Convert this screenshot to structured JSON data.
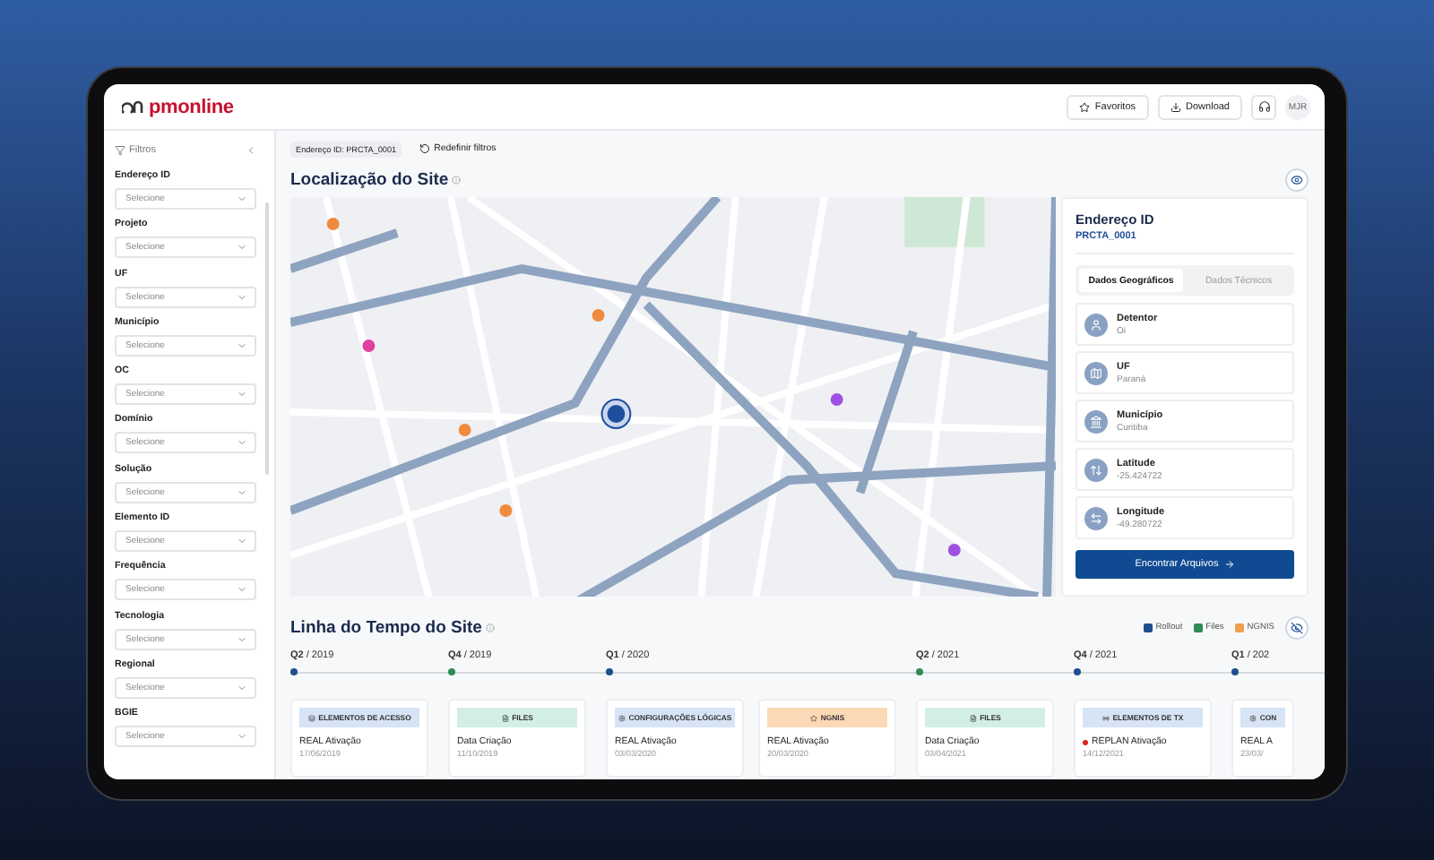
{
  "app": {
    "logo": "pmonline",
    "top_actions": [
      {
        "label": "Favoritos",
        "kind": "star"
      },
      {
        "label": "Download",
        "kind": "download"
      }
    ],
    "user": "MJR"
  },
  "sidebar": {
    "title": "Filtros",
    "filters": [
      {
        "label": "Endereço ID",
        "placeholder": "Selecione"
      },
      {
        "label": "Projeto",
        "placeholder": "Selecione"
      },
      {
        "label": "UF",
        "placeholder": "Selecione"
      },
      {
        "label": "Município",
        "placeholder": "Selecione"
      },
      {
        "label": "OC",
        "placeholder": "Selecione"
      },
      {
        "label": "Domínio",
        "placeholder": "Selecione"
      },
      {
        "label": "Solução",
        "placeholder": "Selecione"
      },
      {
        "label": "Elemento ID",
        "placeholder": "Selecione"
      },
      {
        "label": "Frequência",
        "placeholder": "Selecione"
      },
      {
        "label": "Tecnologia",
        "placeholder": "Selecione"
      },
      {
        "label": "Regional",
        "placeholder": "Selecione"
      },
      {
        "label": "BGIE",
        "placeholder": "Selecione"
      }
    ]
  },
  "breadcrumb": {
    "chip": "Endereço ID: PRCTA_0001",
    "reset": "Redefinir filtros"
  },
  "location": {
    "title": "Localização do Site",
    "card": {
      "title": "Endereço ID",
      "id": "PRCTA_0001",
      "tabs": [
        {
          "label": "Dados Geográficos",
          "selected": true
        },
        {
          "label": "Dados Técnicos",
          "selected": false
        }
      ],
      "fields": [
        {
          "label": "Detentor",
          "value": "Oi",
          "kind": "user"
        },
        {
          "label": "UF",
          "value": "Paraná",
          "kind": "map"
        },
        {
          "label": "Município",
          "value": "Curitiba",
          "kind": "city"
        },
        {
          "label": "Latitude",
          "value": "-25.424722",
          "kind": "lat"
        },
        {
          "label": "Longitude",
          "value": "-49.280722",
          "kind": "lon"
        }
      ],
      "button": "Encontrar Arquivos"
    }
  },
  "timeline": {
    "title": "Linha do Tempo do Site",
    "legend": [
      {
        "label": "Rollout",
        "checked": true,
        "color": "#1f4e8c"
      },
      {
        "label": "Files",
        "checked": true,
        "color": "#2e8b57"
      },
      {
        "label": "NGNIS",
        "checked": true,
        "color": "#f0a04b"
      }
    ],
    "quarters": [
      {
        "label": "**Q2** / 2019",
        "color": "#1f4e8c",
        "events": [
          {
            "tag": "ELEMENTOS DE ACESSO",
            "kind": "access",
            "event": "REAL Ativação",
            "date": "17/06/2019",
            "alert": false
          }
        ]
      },
      {
        "label": "**Q4** / 2019",
        "color": "#2e8b57",
        "events": [
          {
            "tag": "FILES",
            "kind": "files",
            "event": "Data Criação",
            "date": "11/10/2019",
            "alert": false
          }
        ]
      },
      {
        "label": "**Q1** / 2020",
        "color": "#1f4e8c",
        "events": [
          {
            "tag": "CONFIGURAÇÕES LÓGICAS",
            "kind": "config",
            "event": "REAL Ativação",
            "date": "03/03/2020",
            "alert": false
          },
          {
            "tag": "NGNIS",
            "kind": "ngnis",
            "event": "REAL Ativação",
            "date": "20/03/2020",
            "alert": false
          }
        ]
      },
      {
        "label": "**Q2** / 2021",
        "color": "#2e8b57",
        "events": [
          {
            "tag": "FILES",
            "kind": "files",
            "event": "Data Criação",
            "date": "03/04/2021",
            "alert": false
          }
        ]
      },
      {
        "label": "**Q4** / 2021",
        "color": "#1f4e8c",
        "events": [
          {
            "tag": "ELEMENTOS DE TX",
            "kind": "tx",
            "event": "REPLAN Ativação",
            "date": "14/12/2021",
            "alert": true
          }
        ]
      },
      {
        "label": "**Q1** / 202",
        "color": "#1f4e8c",
        "cut": true,
        "events": [
          {
            "tag": "CON",
            "kind": "config",
            "event": "REAL A",
            "date": "23/03/",
            "alert": false
          }
        ]
      }
    ]
  }
}
